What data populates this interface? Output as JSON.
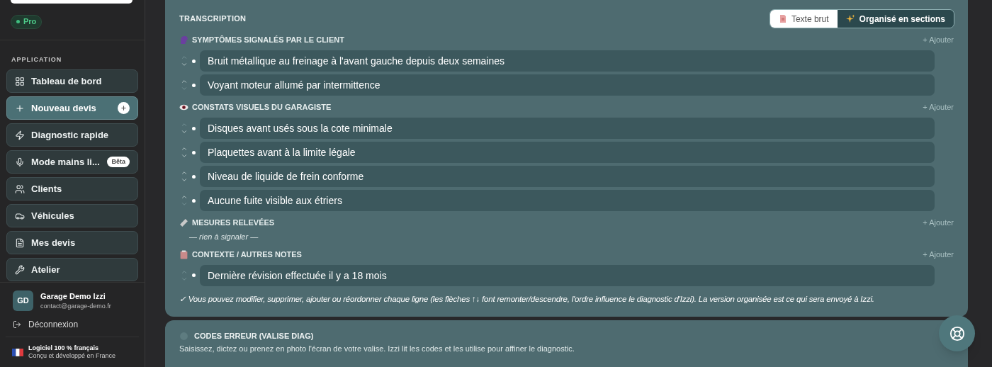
{
  "sidebar": {
    "plan_badge": "Pro",
    "section_label": "APPLICATION",
    "items": [
      {
        "label": "Tableau de bord",
        "selected": false
      },
      {
        "label": "Nouveau devis",
        "selected": true,
        "plus_badge": true
      },
      {
        "label": "Diagnostic rapide",
        "selected": false
      },
      {
        "label": "Mode mains li...",
        "selected": false,
        "badge": "Bêta"
      },
      {
        "label": "Clients",
        "selected": false
      },
      {
        "label": "Véhicules",
        "selected": false
      },
      {
        "label": "Mes devis",
        "selected": false
      },
      {
        "label": "Atelier",
        "selected": false
      }
    ],
    "user": {
      "initials": "GD",
      "name": "Garage Demo Izzi",
      "email": "contact@garage-demo.fr"
    },
    "logout": "Déconnexion",
    "footer": {
      "title": "Logiciel 100 % français",
      "subtitle": "Conçu et développé en France"
    }
  },
  "transcription": {
    "title": "TRANSCRIPTION",
    "toggle": [
      {
        "label": "Texte brut",
        "selected": false
      },
      {
        "label": "Organisé en sections",
        "selected": true
      }
    ],
    "sections": [
      {
        "title": "SYMPTÔMES SIGNALÉS PAR LE CLIENT",
        "add_label": "+ Ajouter",
        "items": [
          "Bruit métallique au freinage à l'avant gauche depuis deux semaines",
          "Voyant moteur allumé par intermittence"
        ]
      },
      {
        "title": "CONSTATS VISUELS DU GARAGISTE",
        "add_label": "+ Ajouter",
        "items": [
          "Disques avant usés sous la cote minimale",
          "Plaquettes avant à la limite légale",
          "Niveau de liquide de frein conforme",
          "Aucune fuite visible aux étriers"
        ]
      },
      {
        "title": "MESURES RELEVÉES",
        "add_label": "+ Ajouter",
        "empty_text": "— rien à signaler —"
      },
      {
        "title": "CONTEXTE / AUTRES NOTES",
        "add_label": "+ Ajouter",
        "items": [
          "Dernière révision effectuée il y a 18 mois"
        ]
      }
    ],
    "footnote": "✓ Vous pouvez modifier, supprimer, ajouter ou réordonner chaque ligne (les flèches ↑↓ font remonter/descendre, l'ordre influence le diagnostic d'Izzi). La version organisée est ce qui sera envoyé à Izzi."
  },
  "error_codes": {
    "title": "CODES ERREUR (VALISE DIAG)",
    "description": "Saisissez, dictez ou prenez en photo l'écran de votre valise. Izzi lit les codes et les utilise pour affiner le diagnostic."
  }
}
